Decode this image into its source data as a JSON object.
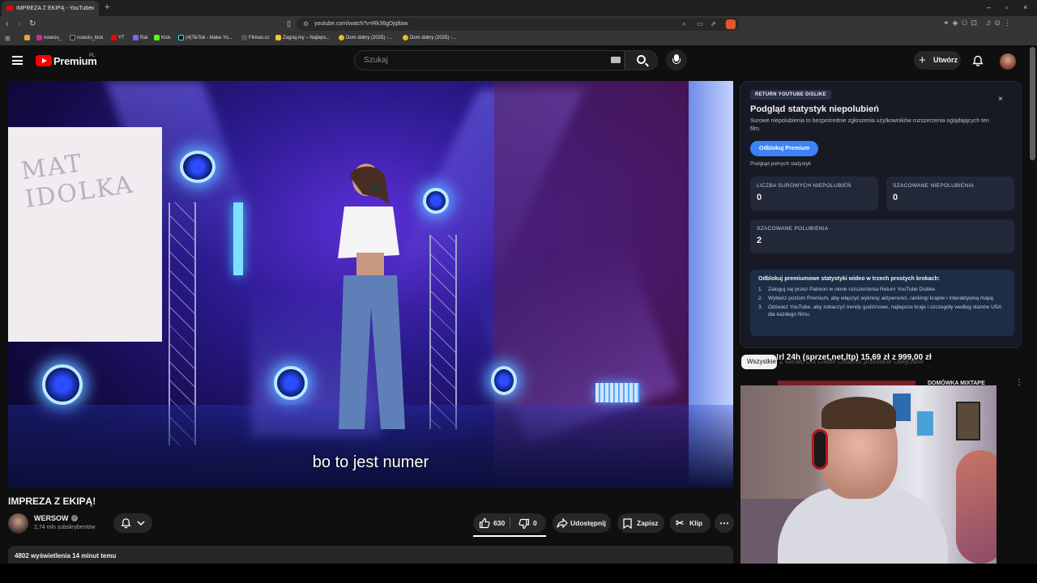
{
  "browser": {
    "tab_title": "IMPREZA Z EKIPĄ - YouTube",
    "url": "youtube.com/watch?v=Rk36gDjq8aw",
    "bookmarks": [
      "nowciu_",
      "nowciu_kick",
      "YT",
      "Rat",
      "Kick",
      "(4)TikTok - Make Yo...",
      "Filman.cc",
      "Zagraj.my – Najleps...",
      "Dom dobry (2025) -...",
      "Dom dobry (2025) -..."
    ]
  },
  "header": {
    "brand": "Premium",
    "brand_sup": "PL",
    "search_placeholder": "Szukaj",
    "create_label": "Utwórz"
  },
  "video": {
    "subtitle": "bo to jest numer",
    "title": "IMPREZA Z EKIPĄ!",
    "channel_name": "WERSOW",
    "subscribers": "2,74 mln subskrybentów",
    "likes": "630",
    "dislikes": "0",
    "share_label": "Udostępnij",
    "save_label": "Zapisz",
    "clip_label": "Klip",
    "views_text": "4802 wyświetlenia  14 minut temu"
  },
  "dislike_panel": {
    "badge": "RETURN YOUTUBE DISLIKE",
    "title": "Podgląd statystyk niepolubień",
    "description": "Surowe niepolubienia to bezpośrednie zgłoszenia użytkowników rozszerzenia oglądających ten film.",
    "unlock_button": "Odblokuj Premium",
    "preview_text": "Podgląd pełnych statystyk",
    "cards": [
      {
        "label": "LICZBA SUROWYCH NIEPOLUBIEŃ",
        "value": "0"
      },
      {
        "label": "SZACOWANE NIEPOLUBIENIA",
        "value": "0"
      },
      {
        "label": "SZACOWANE POLUBIENIA",
        "value": "2"
      }
    ],
    "steps_heading": "Odblokuj premiumowe statystyki wideo w trzech prostych krokach:",
    "steps": [
      "Zaloguj się przez Patreon w oknie rozszerzenia Return YouTube Dislike.",
      "Wybierz poziom Premium, aby włączyć wykresy aktywności, rankingi krajów i interaktywną mapę.",
      "Odśwież YouTube, aby zobaczyć trendy godzinowe, najlepsze kraje i szczegóły według stanów USA dla każdego filmu."
    ]
  },
  "recommendations": {
    "chip_all": "Wszystkie",
    "chips_faded": "Z kanału     Dla Ciebie     Ostatnio przesłane     Obejrzane",
    "overlay_text": "!rl 24h (sprzet,net,ltp)       15,69 zł  z  999,00 zł",
    "first_title": "DOMÓWKA MIXTAPE"
  }
}
